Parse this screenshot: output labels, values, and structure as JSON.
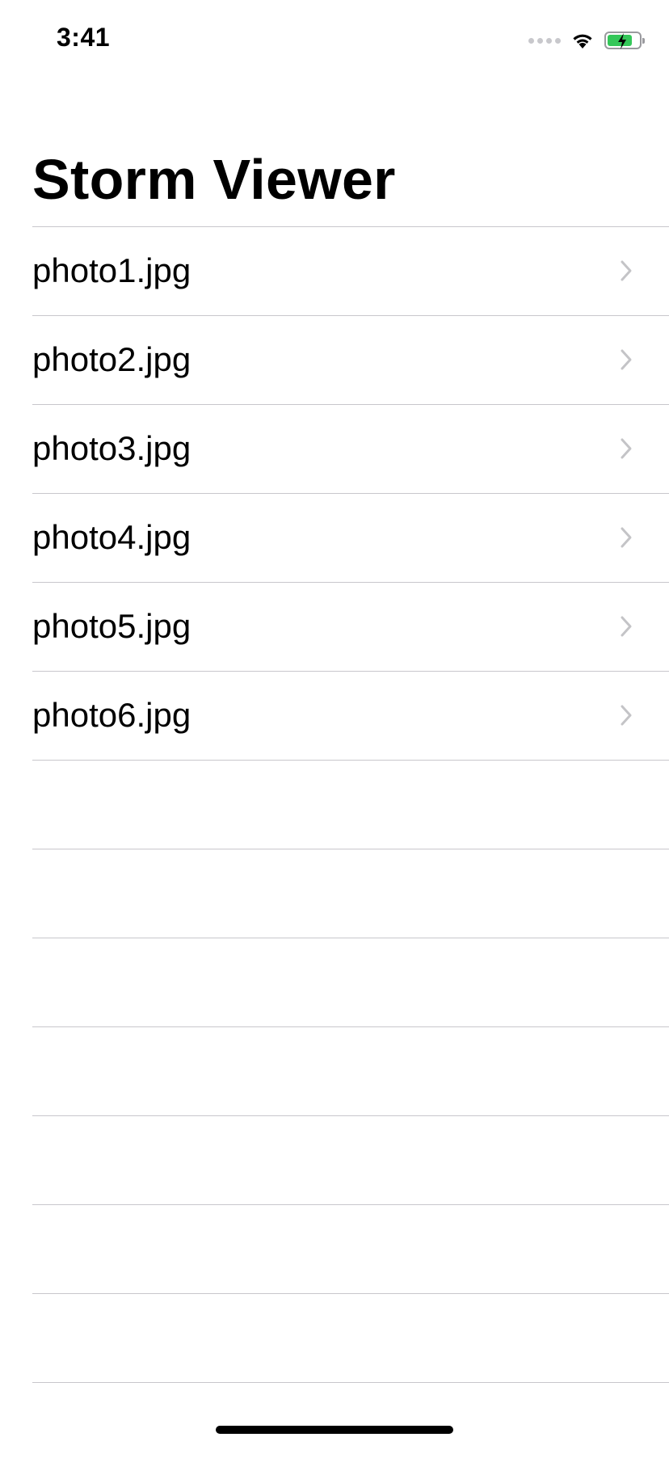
{
  "status_bar": {
    "time": "3:41",
    "battery_color": "#34c759",
    "battery_level": 0.8,
    "icons": [
      "cellular-signal-icon",
      "wifi-icon",
      "battery-charging-icon"
    ]
  },
  "navigation": {
    "title": "Storm Viewer"
  },
  "list": {
    "items": [
      {
        "label": "photo1.jpg",
        "icon": "chevron-right-icon"
      },
      {
        "label": "photo2.jpg",
        "icon": "chevron-right-icon"
      },
      {
        "label": "photo3.jpg",
        "icon": "chevron-right-icon"
      },
      {
        "label": "photo4.jpg",
        "icon": "chevron-right-icon"
      },
      {
        "label": "photo5.jpg",
        "icon": "chevron-right-icon"
      },
      {
        "label": "photo6.jpg",
        "icon": "chevron-right-icon"
      }
    ],
    "separator_color": "#c8c7cc",
    "chevron_color": "#c4c4c7"
  }
}
